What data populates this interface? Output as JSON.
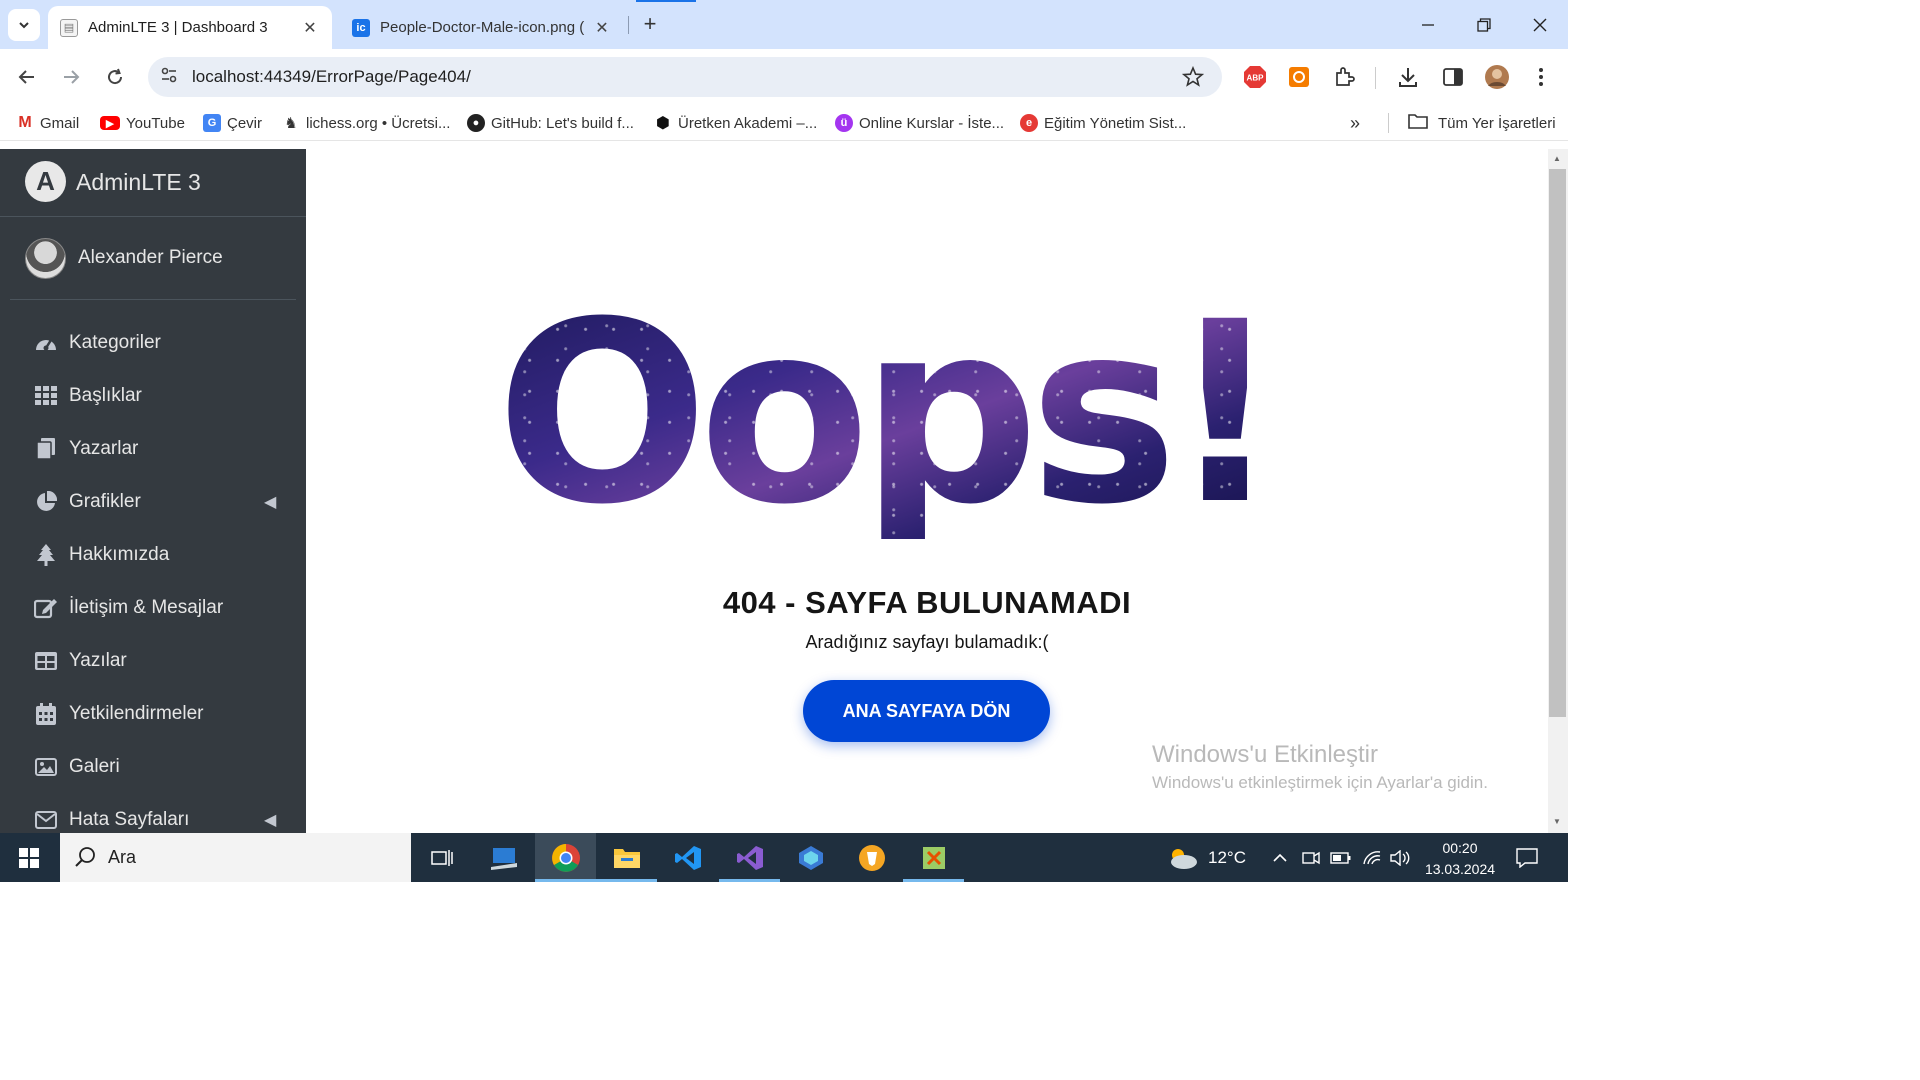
{
  "browser": {
    "tabs": [
      {
        "title": "AdminLTE 3 | Dashboard 3",
        "active": true,
        "icon": "page-icon"
      },
      {
        "title": "People-Doctor-Male-icon.png (",
        "active": false,
        "icon": "iconarchive-icon"
      }
    ],
    "new_tab": "+",
    "url": "localhost:44349/ErrorPage/Page404/",
    "bookmarks": [
      {
        "label": "Gmail",
        "icon": "gmail-icon"
      },
      {
        "label": "YouTube",
        "icon": "youtube-icon"
      },
      {
        "label": "Çevir",
        "icon": "translate-icon"
      },
      {
        "label": "lichess.org • Ücretsi...",
        "icon": "lichess-icon"
      },
      {
        "label": "GitHub: Let's build f...",
        "icon": "github-icon"
      },
      {
        "label": "Üretken Akademi –...",
        "icon": "uretken-icon"
      },
      {
        "label": "Online Kurslar - İste...",
        "icon": "udemy-icon"
      },
      {
        "label": "Eğitim Yönetim Sist...",
        "icon": "edu-icon"
      }
    ],
    "all_bookmarks": "Tüm Yer İşaretleri"
  },
  "sidebar": {
    "brand": "AdminLTE 3",
    "brand_logo": "A",
    "user": "Alexander Pierce",
    "items": [
      {
        "label": "Kategoriler",
        "icon": "dashboard-icon",
        "caret": false
      },
      {
        "label": "Başlıklar",
        "icon": "grid-icon",
        "caret": false
      },
      {
        "label": "Yazarlar",
        "icon": "copy-icon",
        "caret": false
      },
      {
        "label": "Grafikler",
        "icon": "pie-chart-icon",
        "caret": true
      },
      {
        "label": "Hakkımızda",
        "icon": "tree-icon",
        "caret": false
      },
      {
        "label": "İletişim & Mesajlar",
        "icon": "edit-icon",
        "caret": false
      },
      {
        "label": "Yazılar",
        "icon": "table-icon",
        "caret": false
      },
      {
        "label": "Yetkilendirmeler",
        "icon": "calendar-icon",
        "caret": false
      },
      {
        "label": "Galeri",
        "icon": "image-icon",
        "caret": false
      },
      {
        "label": "Hata Sayfaları",
        "icon": "envelope-icon",
        "caret": true
      }
    ]
  },
  "error_page": {
    "headline": "Oops!",
    "title": "404 - SAYFA BULUNAMADI",
    "subtitle": "Aradığınız sayfayı bulamadık:(",
    "button": "ANA SAYFAYA DÖN"
  },
  "watermark": {
    "title": "Windows'u Etkinleştir",
    "subtitle": "Windows'u etkinleştirmek için Ayarlar'a gidin."
  },
  "taskbar": {
    "search_placeholder": "Ara",
    "temperature": "12°C",
    "time": "00:20",
    "date": "13.03.2024",
    "apps": [
      "task-view-icon",
      "desktop-app-icon",
      "chrome-icon",
      "file-explorer-icon",
      "vscode-icon",
      "visual-studio-icon",
      "bing-icon",
      "brave-icon",
      "snipping-icon"
    ]
  },
  "colors": {
    "sidebar_bg": "#343a40",
    "primary_button": "#0046d5",
    "tabstrip": "#d3e3fd"
  }
}
